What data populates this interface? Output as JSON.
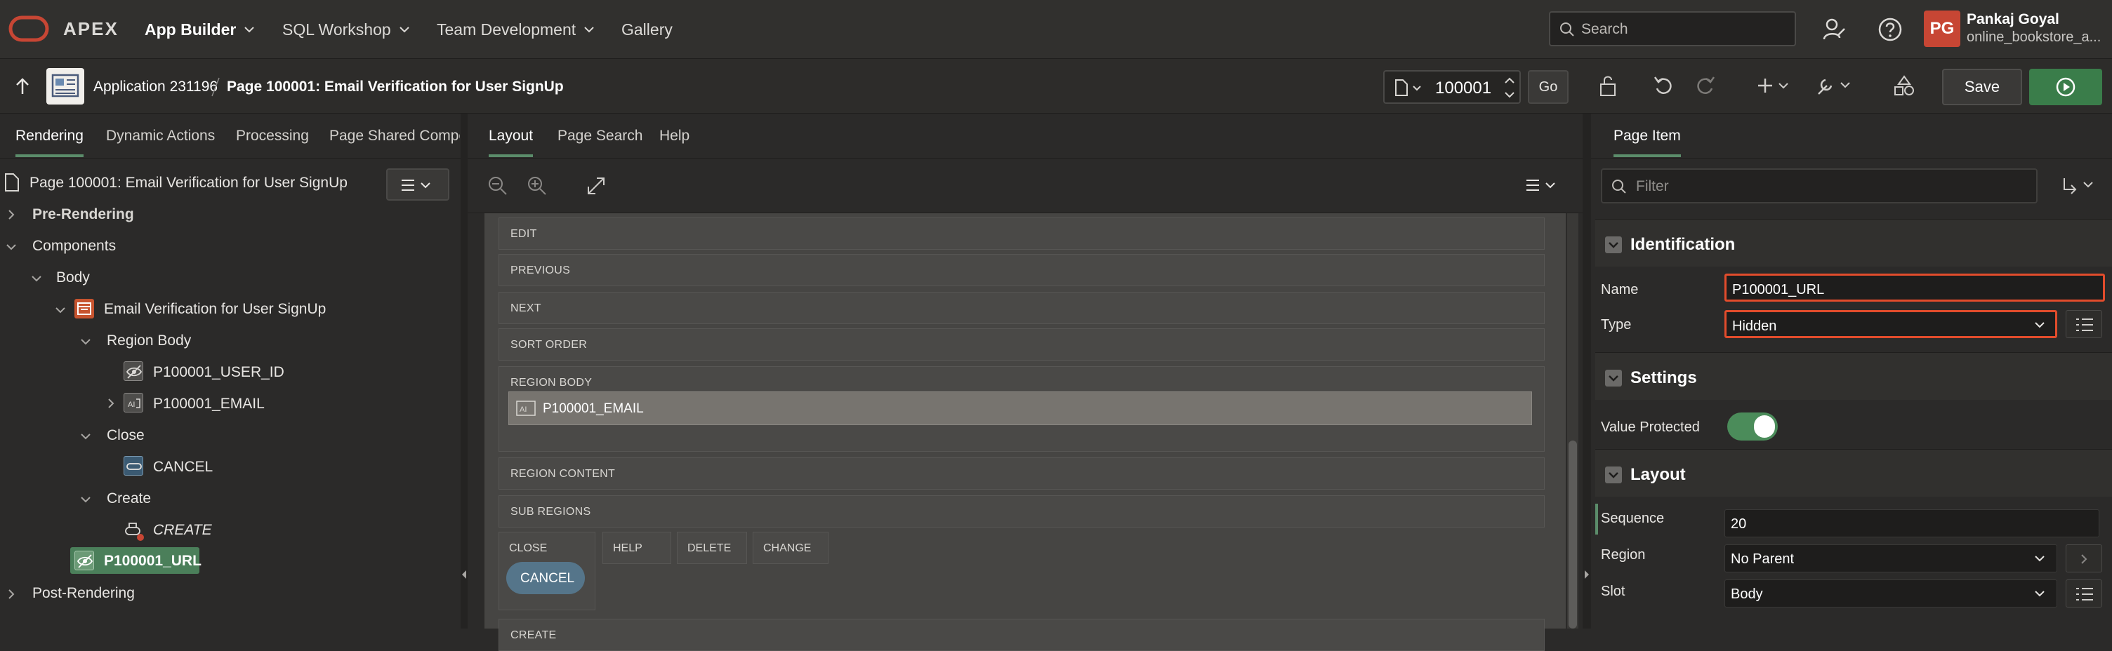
{
  "topbar": {
    "product": "APEX",
    "nav": [
      "App Builder",
      "SQL Workshop",
      "Team Development",
      "Gallery"
    ],
    "search_placeholder": "Search",
    "avatar_initials": "PG",
    "user_name": "Pankaj Goyal",
    "workspace": "online_bookstore_a..."
  },
  "toolbar": {
    "application": "Application 231196",
    "page_title": "Page 100001: Email Verification for User SignUp",
    "page_number": "100001",
    "go_label": "Go",
    "save_label": "Save"
  },
  "left": {
    "tabs": [
      "Rendering",
      "Dynamic Actions",
      "Processing",
      "Page Shared Compor"
    ],
    "root": "Page 100001: Email Verification for User SignUp",
    "tree": {
      "pre_rendering": "Pre-Rendering",
      "components": "Components",
      "body": "Body",
      "region": "Email Verification for User SignUp",
      "region_body": "Region Body",
      "item_user_id": "P100001_USER_ID",
      "item_email": "P100001_EMAIL",
      "close": "Close",
      "cancel": "CANCEL",
      "create": "Create",
      "create_btn": "CREATE",
      "item_url": "P100001_URL",
      "post_rendering": "Post-Rendering"
    }
  },
  "center": {
    "tabs": [
      "Layout",
      "Page Search",
      "Help"
    ],
    "slots": [
      "EDIT",
      "PREVIOUS",
      "NEXT",
      "SORT ORDER",
      "REGION BODY",
      "REGION CONTENT",
      "SUB REGIONS"
    ],
    "email_item": "P100001_EMAIL",
    "mini_slots": [
      "CLOSE",
      "HELP",
      "DELETE",
      "CHANGE"
    ],
    "cancel_button": "CANCEL",
    "bottom_cut": "CREATE"
  },
  "right": {
    "tab": "Page Item",
    "filter_placeholder": "Filter",
    "sections": {
      "identification": "Identification",
      "settings": "Settings",
      "layout": "Layout"
    },
    "labels": {
      "name": "Name",
      "type": "Type",
      "value_protected": "Value Protected",
      "sequence": "Sequence",
      "region": "Region",
      "slot": "Slot"
    },
    "values": {
      "name": "P100001_URL",
      "type": "Hidden",
      "sequence": "20",
      "region": "No Parent",
      "slot": "Body"
    },
    "value_protected": true
  },
  "colors": {
    "accent_green": "#4b7f5a",
    "highlight_red": "#e24c2c",
    "oracle_red": "#c74634"
  }
}
